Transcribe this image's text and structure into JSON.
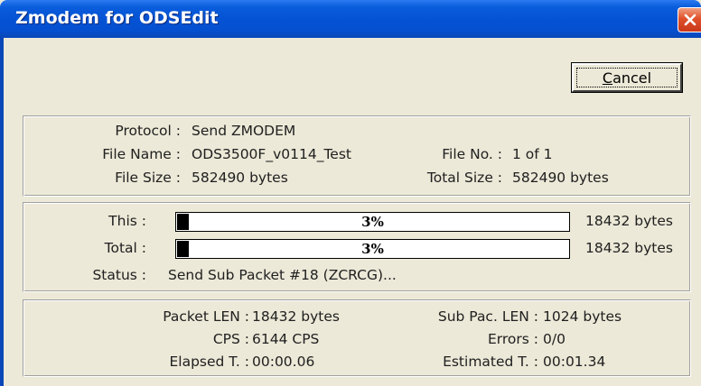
{
  "window": {
    "title": "Zmodem for ODSEdit"
  },
  "buttons": {
    "cancel_prefix": "",
    "cancel_mnemonic": "C",
    "cancel_rest": "ancel"
  },
  "info": {
    "protocol_label": "Protocol :",
    "protocol_value": "Send ZMODEM",
    "filename_label": "File Name :",
    "filename_value": "ODS3500F_v0114_Test",
    "fileno_label": "File No. :",
    "fileno_value": "1 of 1",
    "filesize_label": "File Size :",
    "filesize_value": "582490 bytes",
    "totalsize_label": "Total Size :",
    "totalsize_value": "582490 bytes"
  },
  "progress": {
    "this_label": "This :",
    "this_percent_text": "3%",
    "this_fraction": 0.03,
    "this_bytes": "18432 bytes",
    "total_label": "Total :",
    "total_percent_text": "3%",
    "total_fraction": 0.03,
    "total_bytes": "18432 bytes",
    "status_label": "Status :",
    "status_value": "Send Sub Packet #18 (ZCRCG)..."
  },
  "stats": {
    "packet_len_label": "Packet LEN :",
    "packet_len_value": "18432 bytes",
    "sub_pac_len_label": "Sub Pac. LEN :",
    "sub_pac_len_value": "1024 bytes",
    "cps_label": "CPS :",
    "cps_value": "6144 CPS",
    "errors_label": "Errors :",
    "errors_value": "0/0",
    "elapsed_label": "Elapsed T. :",
    "elapsed_value": "00:00.06",
    "estimated_label": "Estimated T. :",
    "estimated_value": "00:01.34"
  },
  "colors": {
    "titlebar": "#0453d4",
    "dialog_bg": "#ece9d8",
    "close_button": "#e0502a",
    "progress_fill": "#000000"
  },
  "icons": {
    "close": "close-icon"
  }
}
